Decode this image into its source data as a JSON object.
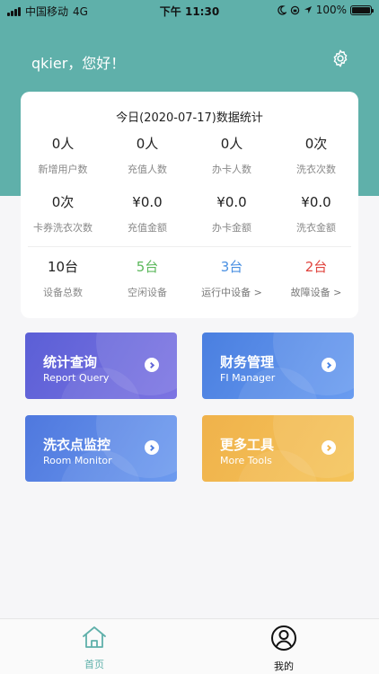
{
  "status_bar": {
    "carrier": "中国移动",
    "network": "4G",
    "time": "下午 11:30",
    "battery": "100%"
  },
  "header": {
    "greeting": "qkier，您好！"
  },
  "stats": {
    "title": "今日(2020-07-17)数据统计",
    "rows": [
      [
        {
          "value": "0人",
          "label": "新增用户数"
        },
        {
          "value": "0人",
          "label": "充值人数"
        },
        {
          "value": "0人",
          "label": "办卡人数"
        },
        {
          "value": "0次",
          "label": "洗衣次数"
        }
      ],
      [
        {
          "value": "0次",
          "label": "卡券洗衣次数"
        },
        {
          "value": "¥0.0",
          "label": "充值金额"
        },
        {
          "value": "¥0.0",
          "label": "办卡金额"
        },
        {
          "value": "¥0.0",
          "label": "洗衣金额"
        }
      ]
    ],
    "devices": [
      {
        "value": "10台",
        "label": "设备总数",
        "color": "#222222"
      },
      {
        "value": "5台",
        "label": "空闲设备",
        "color": "#5cb85c"
      },
      {
        "value": "3台",
        "label": "运行中设备 >",
        "color": "#4a90e2"
      },
      {
        "value": "2台",
        "label": "故障设备 >",
        "color": "#e0443e"
      }
    ]
  },
  "menu": [
    {
      "title": "统计查询",
      "subtitle": "Report Query",
      "gradient": [
        "#5b5fd6",
        "#7c74e2"
      ],
      "arrow_color": "#6568d8"
    },
    {
      "title": "财务管理",
      "subtitle": "FI Manager",
      "gradient": [
        "#4a7fe0",
        "#6a9cf0"
      ],
      "arrow_color": "#4a86e6"
    },
    {
      "title": "洗衣点监控",
      "subtitle": "Room Monitor",
      "gradient": [
        "#4f78de",
        "#6d9bef"
      ],
      "arrow_color": "#5280e2"
    },
    {
      "title": "更多工具",
      "subtitle": "More Tools",
      "gradient": [
        "#f0b24b",
        "#f4c45a"
      ],
      "arrow_color": "#f2b64e"
    }
  ],
  "tabbar": {
    "items": [
      {
        "label": "首页",
        "icon": "home-icon",
        "active": true
      },
      {
        "label": "我的",
        "icon": "user-icon",
        "active": false
      }
    ],
    "active_color": "#5fb0aa"
  },
  "colors": {
    "header_bg": "#5fb0aa",
    "page_bg": "#f6f6f8"
  }
}
